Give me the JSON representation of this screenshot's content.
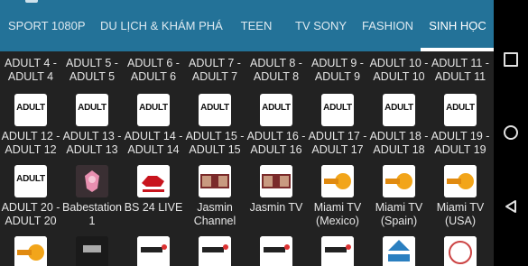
{
  "tabs": [
    {
      "label": "SPORT 1080P"
    },
    {
      "label": "DU LỊCH & KHÁM PHÁ"
    },
    {
      "label": "TEEN"
    },
    {
      "label": "TV SONY"
    },
    {
      "label": "FASHION"
    },
    {
      "label": "SINH HỌC"
    }
  ],
  "active_tab": "SINH HỌC",
  "rows": [
    {
      "labels": [
        "ADULT 4 - ADULT 4",
        "ADULT 5 - ADULT 5",
        "ADULT 6 - ADULT 6",
        "ADULT 7 - ADULT 7",
        "ADULT 8 - ADULT 8",
        "ADULT 9 - ADULT 9",
        "ADULT 10 - ADULT 10",
        "ADULT 11 - ADULT 11"
      ]
    },
    {
      "thumbs": [
        "ADULT",
        "ADULT",
        "ADULT",
        "ADULT",
        "ADULT",
        "ADULT",
        "ADULT",
        "ADULT"
      ],
      "labels": [
        "ADULT 12 - ADULT 12",
        "ADULT 13 - ADULT 13",
        "ADULT 14 - ADULT 14",
        "ADULT 15 - ADULT 15",
        "ADULT 16 - ADULT 16",
        "ADULT 17 - ADULT 17",
        "ADULT 18 - ADULT 18",
        "ADULT 19 - ADULT 19"
      ]
    },
    {
      "labels": [
        "ADULT 20 - ADULT 20",
        "Babestation 1",
        "BS 24 LIVE",
        "Jasmin Channel",
        "Jasmin TV",
        "Miami TV (Mexico)",
        "Miami TV (Spain)",
        "Miami TV (USA)"
      ],
      "thumb_0": "ADULT"
    }
  ],
  "colors": {
    "tabbar": "#237298",
    "background": "#222222",
    "navbar": "#000000"
  },
  "icons": {
    "nav_recent": "square-icon",
    "nav_home": "circle-icon",
    "nav_back": "triangle-back-icon"
  }
}
